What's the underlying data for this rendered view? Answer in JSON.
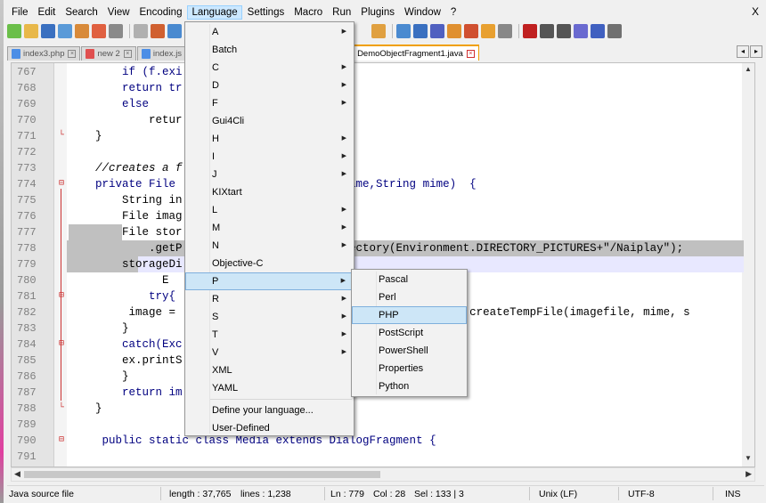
{
  "menubar": {
    "items": [
      "File",
      "Edit",
      "Search",
      "View",
      "Encoding",
      "Language",
      "Settings",
      "Macro",
      "Run",
      "Plugins",
      "Window",
      "?"
    ],
    "active": "Language",
    "close": "X"
  },
  "tabs": [
    {
      "label": "index3.php",
      "icon": "file-icon"
    },
    {
      "label": "new 2",
      "icon": "file-icon-red"
    },
    {
      "label": "index.js",
      "icon": "file-icon"
    },
    {
      "label": "DemoObjectFragment1.java",
      "icon": "file-icon",
      "active": true
    }
  ],
  "tab_nav": {
    "left": "◂",
    "right": "▸"
  },
  "editor": {
    "lines": [
      {
        "n": "767",
        "code": "        if (f.exi"
      },
      {
        "n": "768",
        "code": "        return tr"
      },
      {
        "n": "769",
        "code": "        else"
      },
      {
        "n": "770",
        "code": "            retur"
      },
      {
        "n": "771",
        "code": "    }"
      },
      {
        "n": "772",
        "code": ""
      },
      {
        "n": "773",
        "code": "    //creates a f"
      },
      {
        "n": "774",
        "code": "    private File                          ame,String mime)  {"
      },
      {
        "n": "775",
        "code": "        String in"
      },
      {
        "n": "776",
        "code": "        File imag"
      },
      {
        "n": "777",
        "code": "        File stor"
      },
      {
        "n": "778",
        "code": "            .getP                         ectory(Environment.DIRECTORY_PICTURES+\"/Naiplay\");"
      },
      {
        "n": "779",
        "code": "        storageDi"
      },
      {
        "n": "780",
        "code": "              E"
      },
      {
        "n": "781",
        "code": "            try{"
      },
      {
        "n": "782",
        "code": "         image =                                       File.createTempFile(imagefile, mime, s"
      },
      {
        "n": "783",
        "code": "        }"
      },
      {
        "n": "784",
        "code": "        catch(Exc"
      },
      {
        "n": "785",
        "code": "        ex.printS"
      },
      {
        "n": "786",
        "code": "        }"
      },
      {
        "n": "787",
        "code": "        return im"
      },
      {
        "n": "788",
        "code": "    }"
      },
      {
        "n": "789",
        "code": ""
      },
      {
        "n": "790",
        "code": "     public static class Media extends DialogFragment {"
      },
      {
        "n": "791",
        "code": ""
      }
    ]
  },
  "language_menu": {
    "items": [
      {
        "label": "A",
        "sub": true
      },
      {
        "label": "Batch",
        "sub": false
      },
      {
        "label": "C",
        "sub": true
      },
      {
        "label": "D",
        "sub": true
      },
      {
        "label": "F",
        "sub": true
      },
      {
        "label": "Gui4Cli",
        "sub": false
      },
      {
        "label": "H",
        "sub": true
      },
      {
        "label": "I",
        "sub": true
      },
      {
        "label": "J",
        "sub": true
      },
      {
        "label": "KIXtart",
        "sub": false
      },
      {
        "label": "L",
        "sub": true
      },
      {
        "label": "M",
        "sub": true
      },
      {
        "label": "N",
        "sub": true
      },
      {
        "label": "Objective-C",
        "sub": false
      },
      {
        "label": "P",
        "sub": true,
        "highlight": true
      },
      {
        "label": "R",
        "sub": true
      },
      {
        "label": "S",
        "sub": true
      },
      {
        "label": "T",
        "sub": true
      },
      {
        "label": "V",
        "sub": true
      },
      {
        "label": "XML",
        "sub": false
      },
      {
        "label": "YAML",
        "sub": false
      }
    ],
    "footer": [
      "Define your language...",
      "User-Defined"
    ]
  },
  "p_submenu": {
    "items": [
      "Pascal",
      "Perl",
      "PHP",
      "PostScript",
      "PowerShell",
      "Properties",
      "Python"
    ],
    "highlight": "PHP"
  },
  "statusbar": {
    "filetype": "Java source file",
    "length": "length : 37,765",
    "lines": "lines : 1,238",
    "ln": "Ln : 779",
    "col": "Col : 28",
    "sel": "Sel : 133 | 3",
    "eol": "Unix (LF)",
    "encoding": "UTF-8",
    "mode": "INS"
  },
  "colors": {
    "menu_highlight": "#cde6f7",
    "selection": "#c0c0c0",
    "keyword": "#000080",
    "comment": "#008080",
    "fold_marker": "#cc3333"
  }
}
